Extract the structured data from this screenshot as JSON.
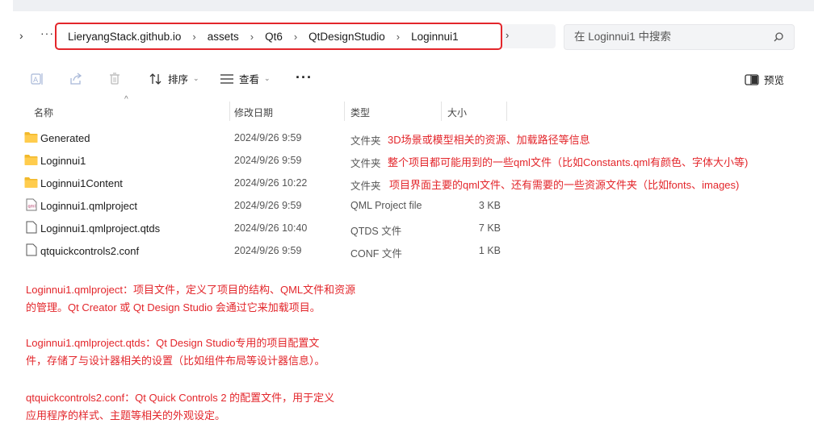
{
  "address_bar": {
    "crumbs": [
      "LieryangStack.github.io",
      "assets",
      "Qt6",
      "QtDesignStudio",
      "Loginnui1"
    ]
  },
  "search": {
    "placeholder": "在 Loginnui1 中搜索"
  },
  "toolbar": {
    "sort_label": "排序",
    "view_label": "查看",
    "preview_label": "预览"
  },
  "columns": {
    "name": "名称",
    "modified": "修改日期",
    "type": "类型",
    "size": "大小"
  },
  "files": [
    {
      "name": "Generated",
      "modified": "2024/9/26 9:59",
      "type": "文件夹",
      "size": "",
      "icon": "folder-icon",
      "note": "3D场景或模型相关的资源、加载路径等信息"
    },
    {
      "name": "Loginnui1",
      "modified": "2024/9/26 9:59",
      "type": "文件夹",
      "size": "",
      "icon": "folder-icon",
      "note": "整个项目都可能用到的一些qml文件（比如Constants.qml有颜色、字体大小等)"
    },
    {
      "name": "Loginnui1Content",
      "modified": "2024/9/26 10:22",
      "type": "文件夹",
      "size": "",
      "icon": "folder-icon",
      "note": "项目界面主要的qml文件、还有需要的一些资源文件夹（比如fonts、images)"
    },
    {
      "name": "Loginnui1.qmlproject",
      "modified": "2024/9/26 9:59",
      "type": "QML Project file",
      "size": "3 KB",
      "icon": "qml-file-icon",
      "note": ""
    },
    {
      "name": "Loginnui1.qmlproject.qtds",
      "modified": "2024/9/26 10:40",
      "type": "QTDS 文件",
      "size": "7 KB",
      "icon": "file-icon",
      "note": ""
    },
    {
      "name": "qtquickcontrols2.conf",
      "modified": "2024/9/26 9:59",
      "type": "CONF 文件",
      "size": "1 KB",
      "icon": "file-icon",
      "note": ""
    }
  ],
  "notes": [
    [
      "Loginnui1.qmlproject：项目文件，定义了项目的结构、QML文件和资源",
      "的管理。Qt Creator 或 Qt Design Studio 会通过它来加载项目。"
    ],
    [
      "Loginnui1.qmlproject.qtds：Qt Design Studio专用的项目配置文",
      "件，存储了与设计器相关的设置（比如组件布局等设计器信息）。"
    ],
    [
      "qtquickcontrols2.conf：Qt Quick Controls 2 的配置文件，用于定义",
      "应用程序的样式、主题等相关的外观设定。"
    ]
  ],
  "colors": {
    "annotation_red": "#e3262b",
    "folder_yellow": "#f2b92b"
  }
}
